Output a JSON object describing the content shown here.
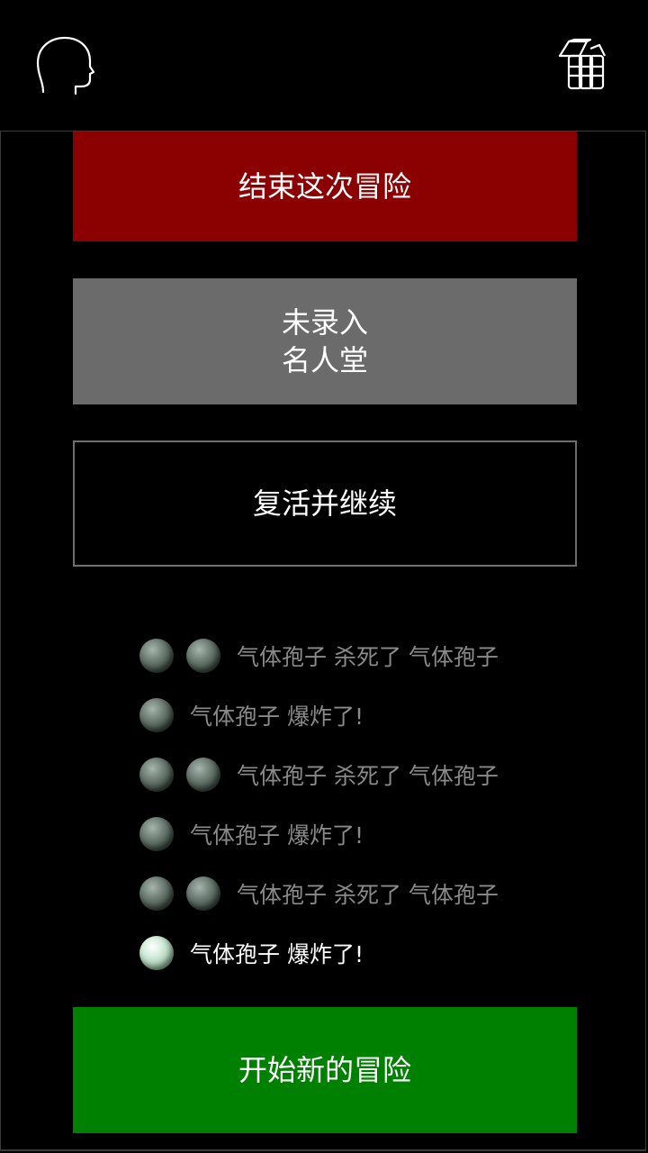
{
  "buttons": {
    "end_adventure": "结束这次冒险",
    "hall_of_fame": "未录入\n名人堂",
    "revive_continue": "复活并继续",
    "new_adventure": "开始新的冒险"
  },
  "log": [
    {
      "orbs": 2,
      "text": "气体孢子 杀死了 气体孢子",
      "highlight": false
    },
    {
      "orbs": 1,
      "text": "气体孢子 爆炸了!",
      "highlight": false
    },
    {
      "orbs": 2,
      "text": "气体孢子 杀死了 气体孢子",
      "highlight": false
    },
    {
      "orbs": 1,
      "text": "气体孢子 爆炸了!",
      "highlight": false
    },
    {
      "orbs": 2,
      "text": "气体孢子 杀死了 气体孢子",
      "highlight": false
    },
    {
      "orbs": 1,
      "text": "气体孢子 爆炸了!",
      "highlight": true
    }
  ],
  "colors": {
    "end_button": "#8b0000",
    "hall_button": "#6b6b6b",
    "new_button": "#008000",
    "log_dim": "#8a8a8a",
    "log_bright": "#ffffff"
  },
  "icons": {
    "left": "head-silhouette-icon",
    "right": "inventory-scroll-icon"
  }
}
